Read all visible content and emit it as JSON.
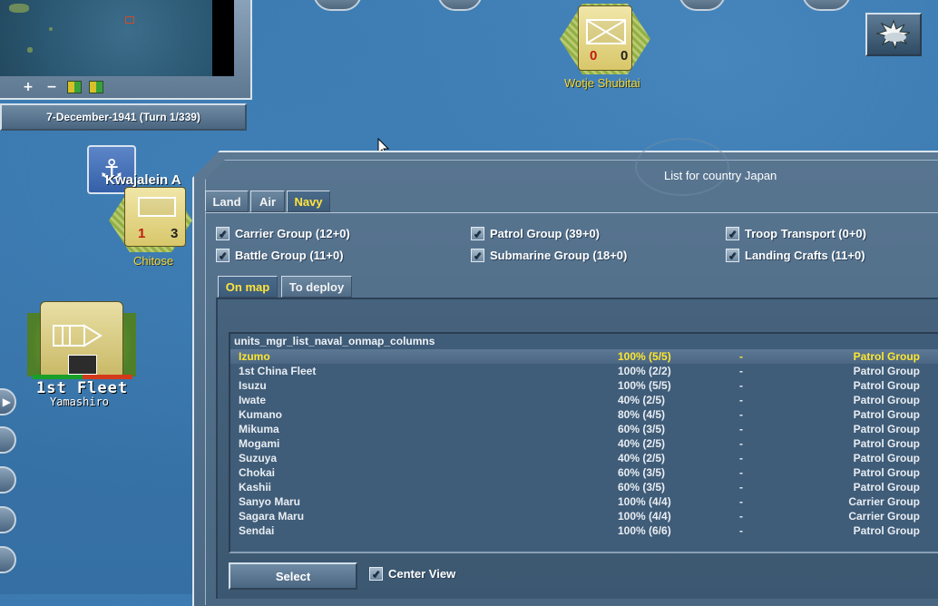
{
  "minimap": {
    "zoom_in": "+",
    "zoom_out": "−"
  },
  "date_turn": "7-December-1941 (Turn 1/339)",
  "map_units": [
    {
      "name": "Wotje Shubitai",
      "left_value": "0",
      "right_value": "0"
    },
    {
      "name": "Chitose",
      "left_value": "1",
      "right_value": "3"
    },
    {
      "name": "Kwajalein A"
    },
    {
      "name": "1st Fleet",
      "sub": "Yamashiro"
    }
  ],
  "panel": {
    "title": "List for country Japan",
    "tabs": [
      {
        "label": "Land",
        "active": false
      },
      {
        "label": "Air",
        "active": false
      },
      {
        "label": "Navy",
        "active": true
      }
    ],
    "filters": [
      {
        "label": "Carrier Group (12+0)",
        "checked": true
      },
      {
        "label": "Patrol Group (39+0)",
        "checked": true
      },
      {
        "label": "Troop Transport (0+0)",
        "checked": true
      },
      {
        "label": "Battle Group (11+0)",
        "checked": true
      },
      {
        "label": "Submarine Group (18+0)",
        "checked": true
      },
      {
        "label": "Landing Crafts (11+0)",
        "checked": true
      }
    ],
    "subtabs": [
      {
        "label": "On map",
        "active": true
      },
      {
        "label": "To deploy",
        "active": false
      }
    ],
    "list_header": "units_mgr_list_naval_onmap_columns",
    "rows": [
      {
        "name": "Izumo",
        "strength": "100% (5/5)",
        "col3": "-",
        "type": "Patrol Group",
        "selected": true
      },
      {
        "name": "1st China Fleet",
        "strength": "100% (2/2)",
        "col3": "-",
        "type": "Patrol Group",
        "selected": false
      },
      {
        "name": "Isuzu",
        "strength": "100% (5/5)",
        "col3": "-",
        "type": "Patrol Group",
        "selected": false
      },
      {
        "name": "Iwate",
        "strength": "40% (2/5)",
        "col3": "-",
        "type": "Patrol Group",
        "selected": false
      },
      {
        "name": "Kumano",
        "strength": "80% (4/5)",
        "col3": "-",
        "type": "Patrol Group",
        "selected": false
      },
      {
        "name": "Mikuma",
        "strength": "60% (3/5)",
        "col3": "-",
        "type": "Patrol Group",
        "selected": false
      },
      {
        "name": "Mogami",
        "strength": "40% (2/5)",
        "col3": "-",
        "type": "Patrol Group",
        "selected": false
      },
      {
        "name": "Suzuya",
        "strength": "40% (2/5)",
        "col3": "-",
        "type": "Patrol Group",
        "selected": false
      },
      {
        "name": "Chokai",
        "strength": "60% (3/5)",
        "col3": "-",
        "type": "Patrol Group",
        "selected": false
      },
      {
        "name": "Kashii",
        "strength": "60% (3/5)",
        "col3": "-",
        "type": "Patrol Group",
        "selected": false
      },
      {
        "name": "Sanyo Maru",
        "strength": "100% (4/4)",
        "col3": "-",
        "type": "Carrier Group",
        "selected": false
      },
      {
        "name": "Sagara Maru",
        "strength": "100% (4/4)",
        "col3": "-",
        "type": "Carrier Group",
        "selected": false
      },
      {
        "name": "Sendai",
        "strength": "100% (6/6)",
        "col3": "-",
        "type": "Patrol Group",
        "selected": false
      }
    ],
    "select_label": "Select",
    "center_view": {
      "label": "Center View",
      "checked": true
    }
  }
}
